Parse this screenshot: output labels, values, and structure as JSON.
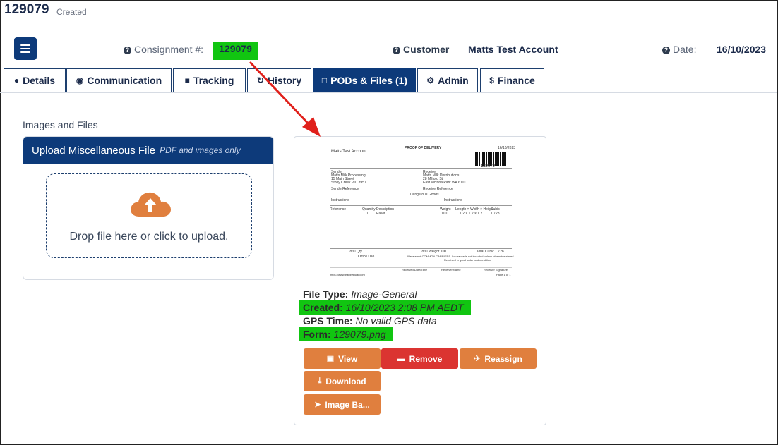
{
  "page": {
    "id": "129079",
    "status": "Created"
  },
  "header": {
    "consignment_label": "Consignment #:",
    "consignment_value": "129079",
    "customer_label": "Customer",
    "customer_value": "Matts Test Account",
    "date_label": "Date:",
    "date_value": "16/10/2023"
  },
  "tabs": [
    {
      "label": "Details",
      "icon": "user-icon"
    },
    {
      "label": "Communication",
      "icon": "comment-icon"
    },
    {
      "label": "Tracking",
      "icon": "truck-icon"
    },
    {
      "label": "History",
      "icon": "history-icon"
    },
    {
      "label": "PODs & Files (1)",
      "icon": "file-icon",
      "active": true
    },
    {
      "label": "Admin",
      "icon": "gear-icon"
    },
    {
      "label": "Finance",
      "icon": "dollar-icon"
    }
  ],
  "section": {
    "label": "Images and Files"
  },
  "upload": {
    "title": "Upload Miscellaneous File",
    "subtitle": "PDF and images only",
    "drop_text": "Drop file here or click to upload."
  },
  "file": {
    "preview": {
      "company": "Matts Test Account",
      "title": "PROOF OF DELIVERY",
      "date": "16/10/2023",
      "number": "129079",
      "sender_label": "Sender",
      "sender_lines": [
        "Matts Milk Processing",
        "15 Main Street",
        "Stony Creek VIC 3957"
      ],
      "receiver_label": "Receiver",
      "receiver_lines": [
        "Matts Milk Distributions",
        "28 Milford St",
        "East Victoria Park WA 6101"
      ],
      "sender_ref": "SenderReference",
      "receiver_ref": "ReceiverReference",
      "dangerous": "Dangerous Goods",
      "instructions": "Instructions",
      "col_ref": "Reference",
      "col_qty": "Quantity",
      "col_desc": "Description",
      "col_weight": "Weight",
      "col_dims": "Length × Width × Height",
      "col_cubic": "Cubic",
      "row_qty": "1",
      "row_desc": "Pallet",
      "row_weight": "100",
      "row_dims": "1.2 × 1.2 × 1.2",
      "row_cubic": "1.728",
      "total_qty": "Total Qty",
      "total_qty_val": "1",
      "total_weight": "Total Weight 100",
      "total_cubic": "Total Cubic 1.728",
      "office": "Office Use",
      "notice1": "We are not COMMON CARRIERS. Insurance is not included unless otherwise stated.",
      "notice2": "Received in good order and condition.",
      "sig1": "Received Date/Time",
      "sig2": "Receiver Name",
      "sig3": "Receiver Signature",
      "url": "https://www.transvirtual.com",
      "page": "Page 1 of 1"
    },
    "type_label": "File Type:",
    "type_value": "Image-General",
    "created_label": "Created:",
    "created_value": "16/10/2023 2:08 PM AEDT",
    "gps_label": "GPS Time:",
    "gps_value": "No valid GPS data",
    "form_label": "Form:",
    "form_value": "129079.png"
  },
  "actions": {
    "view": "View",
    "remove": "Remove",
    "reassign": "Reassign",
    "download": "Download",
    "image_ba": "Image Ba..."
  },
  "colors": {
    "primary": "#0d3a7a",
    "highlight": "#11c511",
    "orange": "#e07f3e",
    "red": "#db3431",
    "arrow": "#e0201b"
  }
}
